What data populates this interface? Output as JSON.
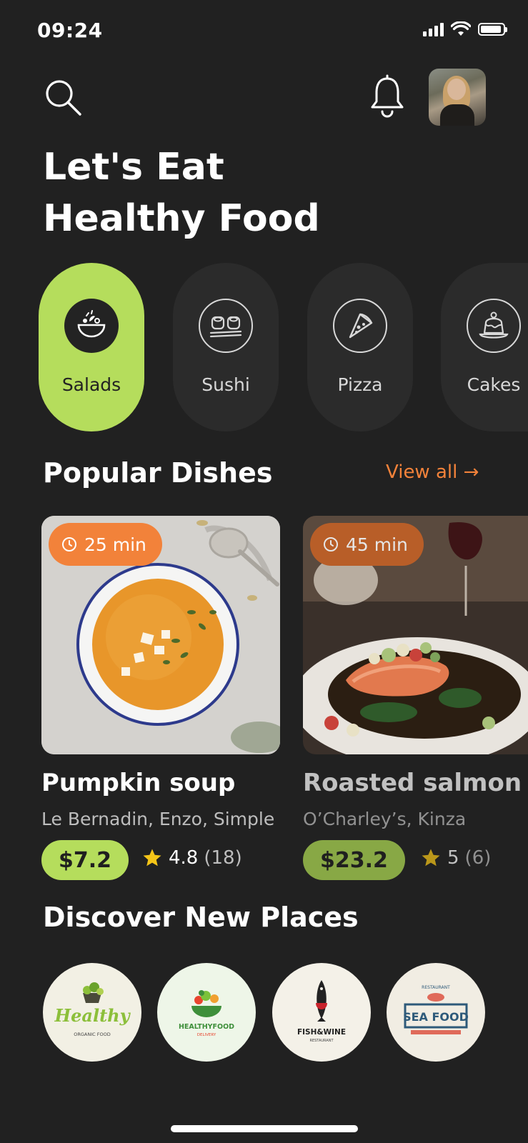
{
  "status_bar": {
    "time": "09:24"
  },
  "header": {
    "search_icon": "search-icon",
    "notification_icon": "bell-icon",
    "title_line1": "Let's Eat",
    "title_line2": "Healthy Food"
  },
  "categories": [
    {
      "label": "Salads",
      "icon": "salad-bowl-icon",
      "active": true
    },
    {
      "label": "Sushi",
      "icon": "sushi-icon",
      "active": false
    },
    {
      "label": "Pizza",
      "icon": "pizza-slice-icon",
      "active": false
    },
    {
      "label": "Cakes",
      "icon": "cake-icon",
      "active": false
    }
  ],
  "popular": {
    "title": "Popular Dishes",
    "view_all": "View all",
    "dishes": [
      {
        "time": "25 min",
        "name": "Pumpkin soup",
        "restaurants": "Le Bernadin, Enzo, Simple",
        "price": "$7.2",
        "rating": "4.8",
        "reviews": "(18)"
      },
      {
        "time": "45 min",
        "name": "Roasted salmon",
        "restaurants": "O’Charley’s, Kinza",
        "price": "$23.2",
        "rating": "5",
        "reviews": "(6)"
      }
    ]
  },
  "discover": {
    "title": "Discover New Places",
    "places": [
      {
        "logo_text": "Healthy",
        "sub_text": "ORGANIC FOOD"
      },
      {
        "logo_text": "HEALTHYFOOD",
        "sub_text": "DELIVERY"
      },
      {
        "logo_text": "FISH&WINE",
        "sub_text": "RESTAURANT"
      },
      {
        "logo_text": "SEA FOOD",
        "sub_text": "RESTAURANT"
      }
    ]
  },
  "colors": {
    "accent_green": "#b5dd5c",
    "accent_orange": "#f2823a",
    "background": "#212121",
    "card": "#2b2b2b"
  }
}
